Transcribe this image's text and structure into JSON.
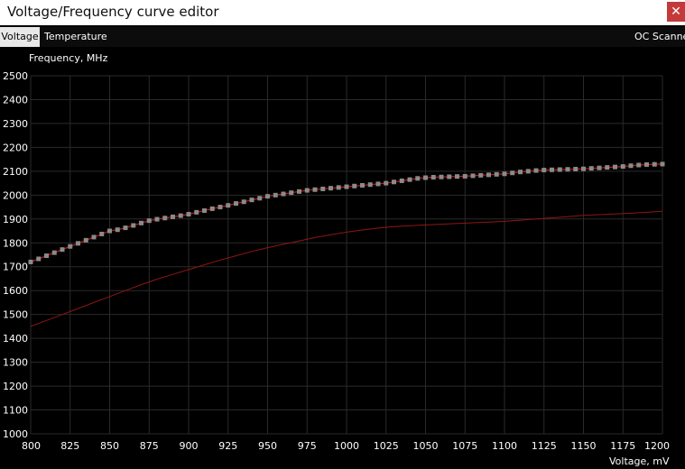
{
  "window": {
    "title": "Voltage/Frequency curve editor",
    "close_glyph": "✕"
  },
  "tabs": [
    {
      "label": "Voltage",
      "active": true
    },
    {
      "label": "Temperature",
      "active": false
    }
  ],
  "oc_scanner_label": "OC Scanne",
  "colors": {
    "background": "#000000",
    "grid": "#2a2a2a",
    "curve": "#c21a1a",
    "point": "#8a8a8a",
    "tab_active": "#e8e8e8",
    "close_button": "#c43a3a"
  },
  "chart_data": {
    "type": "line",
    "xlabel": "Voltage, mV",
    "ylabel": "Frequency, MHz",
    "xlim": [
      800,
      1200
    ],
    "ylim": [
      1000,
      2500
    ],
    "x_ticks": [
      800,
      825,
      850,
      875,
      900,
      925,
      950,
      975,
      1000,
      1025,
      1050,
      1075,
      1100,
      1125,
      1150,
      1175,
      1200
    ],
    "y_ticks": [
      1000,
      1100,
      1200,
      1300,
      1400,
      1500,
      1600,
      1700,
      1800,
      1900,
      2000,
      2100,
      2200,
      2300,
      2400,
      2500
    ],
    "grid": true,
    "series": [
      {
        "role": "edited curve with points",
        "x": [
          800,
          805,
          810,
          815,
          820,
          825,
          830,
          835,
          840,
          845,
          850,
          855,
          860,
          865,
          870,
          875,
          880,
          885,
          890,
          895,
          900,
          905,
          910,
          915,
          920,
          925,
          930,
          935,
          940,
          945,
          950,
          955,
          960,
          965,
          970,
          975,
          980,
          985,
          990,
          995,
          1000,
          1005,
          1010,
          1015,
          1020,
          1025,
          1030,
          1035,
          1040,
          1045,
          1050,
          1055,
          1060,
          1065,
          1070,
          1075,
          1080,
          1085,
          1090,
          1095,
          1100,
          1105,
          1110,
          1115,
          1120,
          1125,
          1130,
          1135,
          1140,
          1145,
          1150,
          1155,
          1160,
          1165,
          1170,
          1175,
          1180,
          1185,
          1190,
          1195,
          1200
        ],
        "y": [
          1720,
          1733,
          1746,
          1759,
          1772,
          1785,
          1798,
          1811,
          1824,
          1837,
          1850,
          1855,
          1863,
          1873,
          1883,
          1893,
          1899,
          1904,
          1909,
          1914,
          1920,
          1928,
          1935,
          1943,
          1950,
          1957,
          1965,
          1972,
          1980,
          1987,
          1995,
          2000,
          2005,
          2010,
          2015,
          2020,
          2023,
          2026,
          2029,
          2032,
          2035,
          2038,
          2041,
          2044,
          2047,
          2050,
          2055,
          2060,
          2065,
          2070,
          2073,
          2075,
          2076,
          2077,
          2078,
          2079,
          2081,
          2083,
          2085,
          2087,
          2089,
          2093,
          2097,
          2100,
          2103,
          2105,
          2106,
          2107,
          2108,
          2109,
          2110,
          2112,
          2114,
          2116,
          2118,
          2120,
          2123,
          2126,
          2128,
          2129,
          2130
        ]
      },
      {
        "role": "default curve",
        "x": [
          800,
          810,
          820,
          830,
          840,
          850,
          860,
          870,
          880,
          890,
          900,
          910,
          920,
          930,
          940,
          950,
          960,
          970,
          980,
          990,
          1000,
          1010,
          1020,
          1030,
          1040,
          1050,
          1060,
          1070,
          1080,
          1090,
          1100,
          1110,
          1120,
          1130,
          1140,
          1150,
          1160,
          1170,
          1180,
          1190,
          1200
        ],
        "y": [
          1450,
          1475,
          1500,
          1525,
          1550,
          1575,
          1600,
          1625,
          1648,
          1668,
          1688,
          1708,
          1728,
          1746,
          1764,
          1780,
          1794,
          1808,
          1822,
          1834,
          1845,
          1854,
          1862,
          1868,
          1872,
          1875,
          1878,
          1881,
          1884,
          1887,
          1890,
          1895,
          1900,
          1905,
          1910,
          1915,
          1918,
          1921,
          1924,
          1928,
          1932
        ]
      }
    ]
  }
}
